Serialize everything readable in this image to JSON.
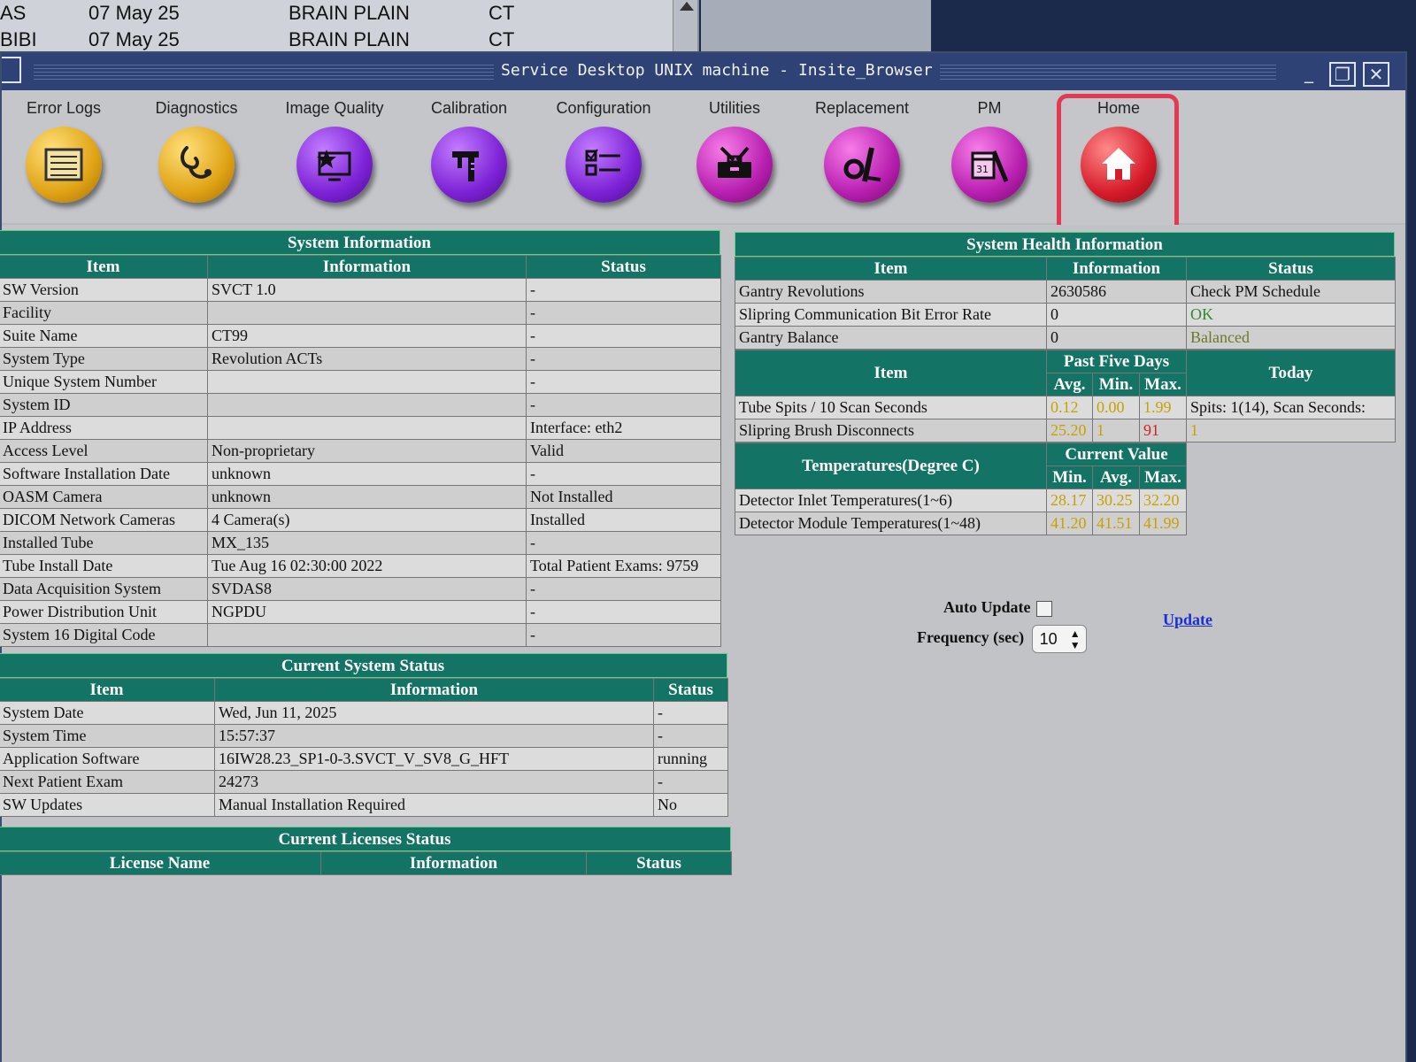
{
  "background_window": {
    "rows": [
      {
        "c1": "AS",
        "c2": "07 May 25",
        "c3": "BRAIN PLAIN",
        "c4": "CT"
      },
      {
        "c1": "BIBI",
        "c2": "07 May 25",
        "c3": "BRAIN PLAIN",
        "c4": "CT"
      }
    ]
  },
  "window": {
    "title": "Service Desktop UNIX machine - Insite_Browser",
    "minimize": "_",
    "restore": "❐",
    "close": "✕"
  },
  "toolbar": {
    "items": [
      {
        "label": "Error Logs",
        "icon": "error-log-icon"
      },
      {
        "label": "Diagnostics",
        "icon": "stethoscope-icon"
      },
      {
        "label": "Image Quality",
        "icon": "image-quality-icon"
      },
      {
        "label": "Calibration",
        "icon": "caliper-icon"
      },
      {
        "label": "Configuration",
        "icon": "checklist-icon"
      },
      {
        "label": "Utilities",
        "icon": "toolbox-icon"
      },
      {
        "label": "Replacement",
        "icon": "wrench-icon"
      },
      {
        "label": "PM",
        "icon": "calendar-wrench-icon"
      },
      {
        "label": "Home",
        "icon": "home-icon"
      }
    ]
  },
  "system_info": {
    "caption": "System Information",
    "headers": [
      "Item",
      "Information",
      "Status"
    ],
    "rows": [
      {
        "item": "SW Version",
        "info": "SVCT 1.0",
        "status": "-"
      },
      {
        "item": "Facility",
        "info": "",
        "status": "-"
      },
      {
        "item": "Suite Name",
        "info": "CT99",
        "status": "-"
      },
      {
        "item": "System Type",
        "info": "Revolution ACTs",
        "status": "-"
      },
      {
        "item": "Unique System Number",
        "info": "",
        "status": "-"
      },
      {
        "item": "System ID",
        "info": "",
        "status": "-"
      },
      {
        "item": "IP Address",
        "info": "",
        "status": "Interface: eth2"
      },
      {
        "item": "Access Level",
        "info": "Non-proprietary",
        "status": "Valid"
      },
      {
        "item": "Software Installation Date",
        "info": "unknown",
        "status": "-"
      },
      {
        "item": "OASM Camera",
        "info": "unknown",
        "status": "Not Installed"
      },
      {
        "item": "DICOM Network Cameras",
        "info": "4 Camera(s)",
        "status": "Installed"
      },
      {
        "item": "Installed Tube",
        "info": "MX_135",
        "status": "-"
      },
      {
        "item": "Tube Install Date",
        "info": "Tue Aug 16 02:30:00 2022",
        "status": "Total Patient Exams: 9759"
      },
      {
        "item": "Data Acquisition System",
        "info": "SVDAS8",
        "status": "-"
      },
      {
        "item": "Power Distribution Unit",
        "info": "NGPDU",
        "status": "-"
      },
      {
        "item": "System 16 Digital Code",
        "info": "",
        "status": "-"
      }
    ]
  },
  "current_status": {
    "caption": "Current System Status",
    "headers": [
      "Item",
      "Information",
      "Status"
    ],
    "rows": [
      {
        "item": "System Date",
        "info": "Wed, Jun 11, 2025",
        "status": "-"
      },
      {
        "item": "System Time",
        "info": "15:57:37",
        "status": "-"
      },
      {
        "item": "Application Software",
        "info": "16IW28.23_SP1-0-3.SVCT_V_SV8_G_HFT",
        "status": "running"
      },
      {
        "item": "Next Patient Exam",
        "info": "24273",
        "status": "-"
      },
      {
        "item": "SW Updates",
        "info": "Manual Installation Required",
        "status": "No"
      }
    ]
  },
  "licenses": {
    "caption": "Current Licenses Status",
    "headers": [
      "License Name",
      "Information",
      "Status"
    ]
  },
  "health": {
    "caption": "System Health Information",
    "headers": [
      "Item",
      "Information",
      "Status"
    ],
    "rows": [
      {
        "item": "Gantry Revolutions",
        "info": "2630586",
        "status": "Check PM Schedule"
      },
      {
        "item": "Slipring Communication Bit Error Rate",
        "info": "0",
        "status": "OK"
      },
      {
        "item": "Gantry Balance",
        "info": "0",
        "status": "Balanced"
      }
    ],
    "five_days": {
      "item_header": "Item",
      "group_header": "Past Five Days",
      "avg": "Avg.",
      "min": "Min.",
      "max": "Max.",
      "today_header": "Today",
      "rows": [
        {
          "item": "Tube Spits / 10 Scan Seconds",
          "avg": "0.12",
          "min": "0.00",
          "max": "1.99",
          "today": "Spits: 1(14), Scan Seconds:"
        },
        {
          "item": "Slipring Brush Disconnects",
          "avg": "25.20",
          "min": "1",
          "max": "91",
          "today": "1"
        }
      ]
    },
    "temps": {
      "item_header": "Temperatures(Degree C)",
      "group_header": "Current Value",
      "min": "Min.",
      "avg": "Avg.",
      "max": "Max.",
      "rows": [
        {
          "item": "Detector Inlet Temperatures(1~6)",
          "min": "28.17",
          "avg": "30.25",
          "max": "32.20"
        },
        {
          "item": "Detector Module Temperatures(1~48)",
          "min": "41.20",
          "avg": "41.51",
          "max": "41.99"
        }
      ]
    }
  },
  "controls": {
    "auto_update_label": "Auto Update",
    "frequency_label": "Frequency (sec)",
    "frequency_value": "10",
    "update_link": "Update"
  },
  "colors": {
    "header_teal": "#137365",
    "home_tab_red": "#e23a52",
    "link_blue": "#1a2fd0"
  }
}
